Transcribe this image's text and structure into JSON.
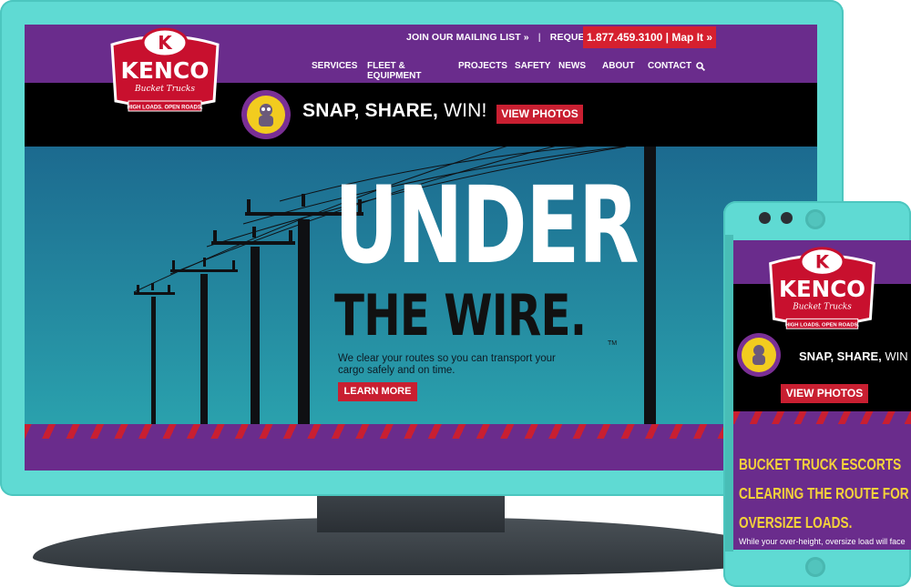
{
  "brand": {
    "name": "KENCO",
    "subname": "Bucket Trucks",
    "tagline": "HIGH LOADS. OPEN ROADS.",
    "logo_letter": "K"
  },
  "colors": {
    "purple": "#6a2c8c",
    "red": "#d6202f",
    "teal_device": "#5fdad3",
    "yellow_text": "#f4d23a"
  },
  "desktop": {
    "top_links": {
      "mailing_list": "JOIN OUR MAILING LIST »",
      "separator": "|",
      "quote": "REQUEST A QUOTE »",
      "phone_button": "1.877.459.3100 | Map It »"
    },
    "nav": [
      "SERVICES",
      "FLEET & EQUIPMENT",
      "PROJECTS",
      "SAFETY",
      "NEWS",
      "ABOUT",
      "CONTACT"
    ],
    "search_icon": "search-icon",
    "promo": {
      "snap": "SNAP, SHARE,",
      "win": " WIN!",
      "button": "VIEW PHOTOS"
    },
    "hero": {
      "line1": "UNDER",
      "line2": "THE WIRE.",
      "trademark": "TM",
      "tagline": "We clear your routes so you can transport your cargo safely and on time.",
      "button": "LEARN MORE"
    }
  },
  "mobile": {
    "promo": {
      "snap": "SNAP, SHARE,",
      "win": " WIN",
      "button": "VIEW PHOTOS"
    },
    "headline": [
      "BUCKET TRUCK ESCORTS",
      "CLEARING THE ROUTE FOR",
      "OVERSIZE LOADS."
    ],
    "subtext": "While your over-height, oversize load will face"
  }
}
